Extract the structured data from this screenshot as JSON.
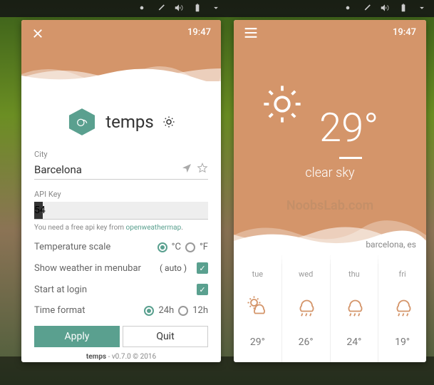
{
  "time": "19:47",
  "app": {
    "name": "temps",
    "version": "v0.7.0",
    "copyright": "© 2016"
  },
  "settings": {
    "city_label": "City",
    "city_value": "Barcelona",
    "api_label": "API Key",
    "api_value_prefix": "54",
    "hint_prefix": "You need a free api key from ",
    "hint_link": "openweathermap",
    "temp_scale_label": "Temperature scale",
    "temp_c": "°C",
    "temp_f": "°F",
    "temp_selected": "C",
    "menubar_label": "Show weather in menubar",
    "menubar_mode": "auto",
    "menubar_checked": true,
    "startup_label": "Start at login",
    "startup_checked": true,
    "timefmt_label": "Time format",
    "timefmt_24": "24h",
    "timefmt_12": "12h",
    "timefmt_selected": "24h",
    "apply": "Apply",
    "quit": "Quit"
  },
  "weather": {
    "temp": "29°",
    "condition": "clear sky",
    "location": "barcelona, es",
    "watermark": "NoobsLab.com",
    "forecast": [
      {
        "day": "tue",
        "icon": "partly-cloudy",
        "temp": "29°"
      },
      {
        "day": "wed",
        "icon": "rain",
        "temp": "26°"
      },
      {
        "day": "thu",
        "icon": "rain",
        "temp": "24°"
      },
      {
        "day": "fri",
        "icon": "rain",
        "temp": "19°"
      }
    ]
  },
  "colors": {
    "accent": "#5aa08f",
    "header": "#d4956a"
  }
}
